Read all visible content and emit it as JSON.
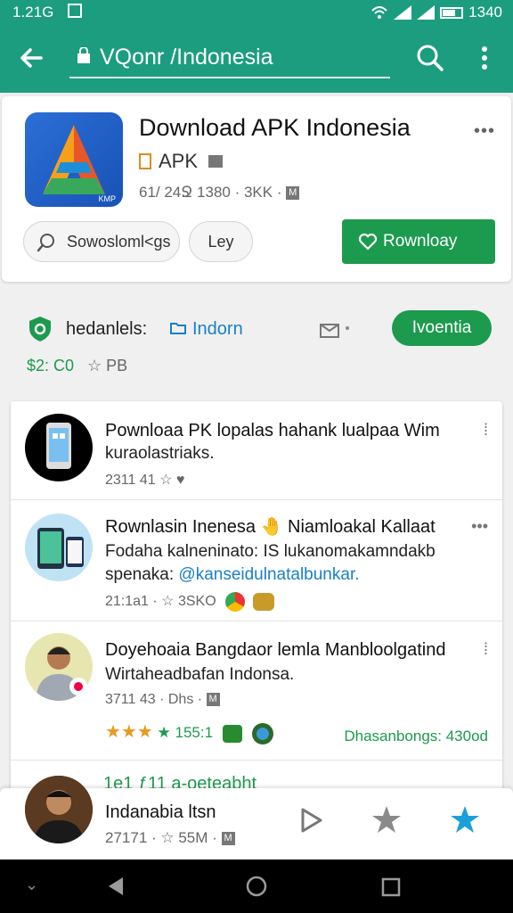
{
  "status_bar": {
    "time_left": "1.21G",
    "time_right": "1340"
  },
  "toolbar": {
    "url": "VQonr /Indonesia",
    "icons": [
      "back-arrow-icon",
      "lock-icon",
      "search-icon",
      "more-vert-icon"
    ]
  },
  "app": {
    "title": "Download APK Indonesia",
    "subtitle": "APK",
    "meta": "61/ 24Ջ 1380 · 3KK ·",
    "meta_badge": "M",
    "chip_search": "Sowosloml<gs",
    "chip_second": "Ley",
    "download_label": "Rownloay"
  },
  "section": {
    "name": "hedanlels:",
    "link": "Indorn",
    "pill": "Ivoentia",
    "price": "$2: C0",
    "rating": "☆ PB"
  },
  "list": [
    {
      "title": "Pownloaa PK lopalas hahank lualpaa Wim",
      "desc": [
        "kuraolastriaks."
      ],
      "meta": "2311 41"
    },
    {
      "title": "Rownlasin Inenesa",
      "title_suffix": "Niamloakal Kallaat",
      "desc": [
        "Fodaha kalneninato: IS lukanomakamndakb",
        "spenaka:"
      ],
      "desc_link": "@kanseidulnatalbunkar.",
      "meta": "21:1a1 · ☆ 3SKO"
    },
    {
      "title": "Doyehoaia Bangdaor lemla Manbloolgatind",
      "desc": [
        "Wirtaheadbafan Indonsa."
      ],
      "meta": "3711 43 · Dhs ·",
      "meta_badge": "M",
      "rating_text": "★★★",
      "extra_rating": "★ 155:1",
      "right_text": "Dhasanbongs: 430od"
    }
  ],
  "peek_text": "1e1 ƒ11   a-oeteabht",
  "bottom": {
    "title": "Indanabia ltsn",
    "meta": "27171 · ☆ 55M ·",
    "meta_badge": "M"
  },
  "colors": {
    "primary": "#1c9d80",
    "green": "#1c9a4e",
    "link": "#1a7fc7",
    "star": "#e89a1c",
    "active_star": "#1a9fd8"
  }
}
